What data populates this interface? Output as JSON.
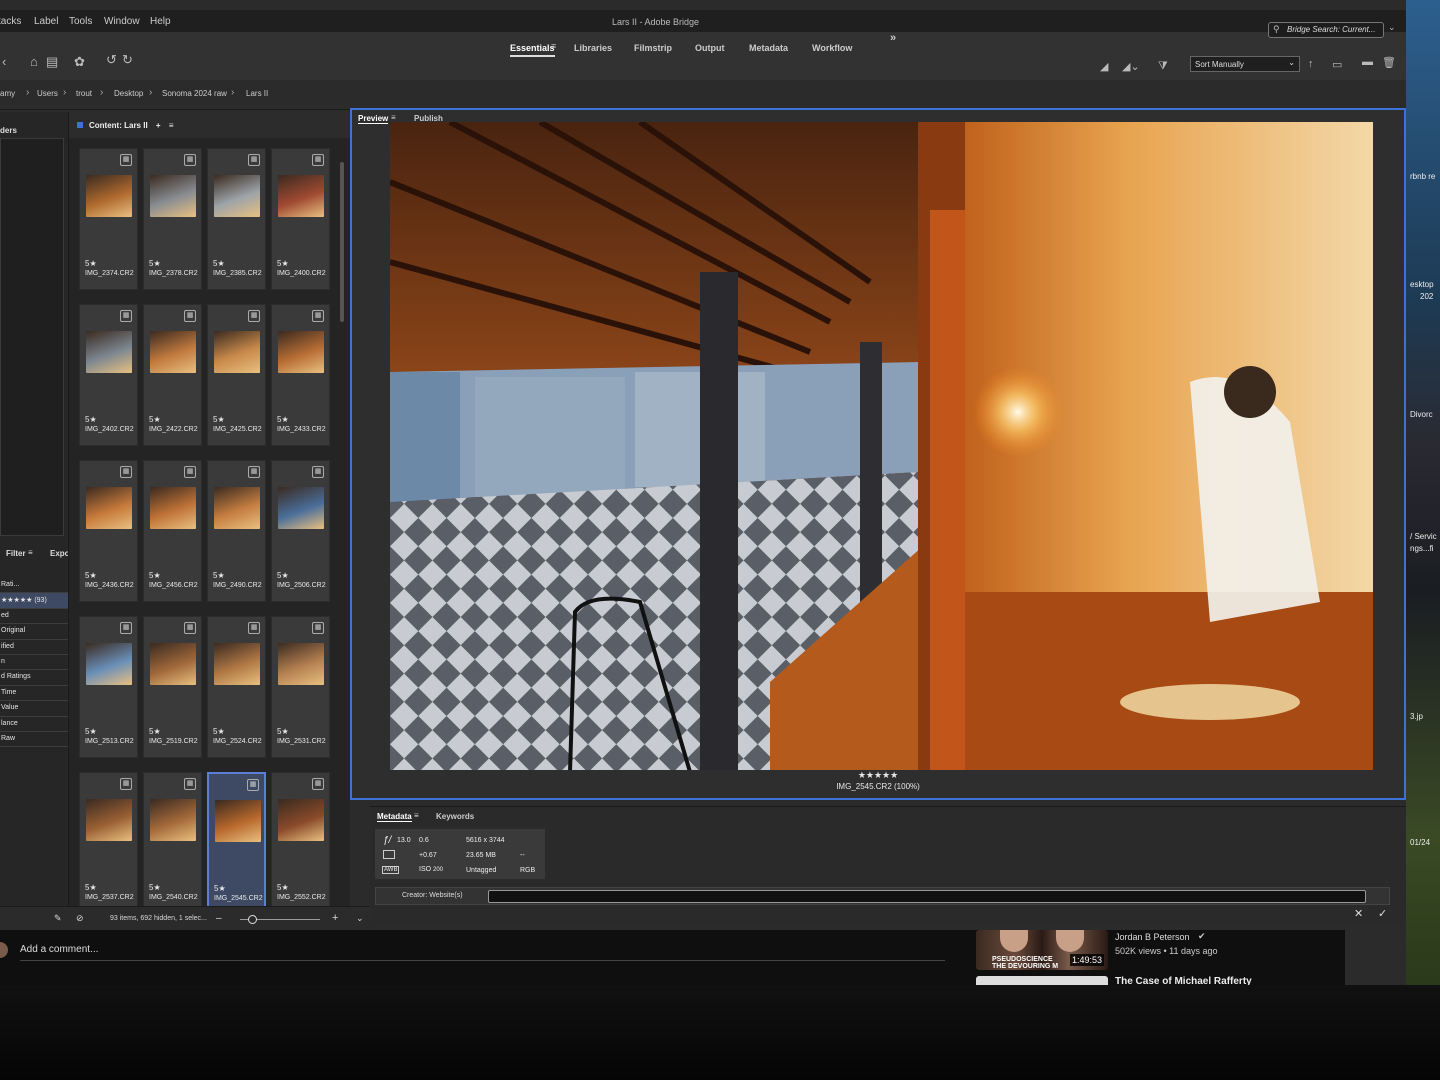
{
  "window": {
    "title": "Lars II - Adobe Bridge"
  },
  "menu": [
    "tacks",
    "Label",
    "Tools",
    "Window",
    "Help"
  ],
  "workspaces": {
    "items": [
      "Essentials",
      "Libraries",
      "Filmstrip",
      "Output",
      "Metadata",
      "Workflow"
    ],
    "active": "Essentials",
    "more": "»"
  },
  "search": {
    "placeholder": "Bridge Search: Current..."
  },
  "sort": {
    "value": "Sort Manually"
  },
  "breadcrumb": [
    "amy",
    "Users",
    "trout",
    "Desktop",
    "Sonoma 2024 raw",
    "Lars II"
  ],
  "left_panel": {
    "favorites_label": "ders",
    "filter_tab": "Filter",
    "export_tab": "Expo",
    "filter_rows": [
      "Rati...",
      "★★★★★ (93)",
      "ed",
      "Original",
      "ified",
      "n",
      "d Ratings",
      "Time",
      "Value",
      "lance",
      "Raw"
    ]
  },
  "content": {
    "header": "Content: Lars II",
    "status": "93 items, 692 hidden, 1 selec...",
    "thumbnails": [
      {
        "name": "IMG_2374.CR2",
        "stars": "5★",
        "color": "#b06a2e"
      },
      {
        "name": "IMG_2378.CR2",
        "stars": "5★",
        "color": "#8a8d92"
      },
      {
        "name": "IMG_2385.CR2",
        "stars": "5★",
        "color": "#9da3a8"
      },
      {
        "name": "IMG_2400.CR2",
        "stars": "5★",
        "color": "#a04a32"
      },
      {
        "name": "IMG_2402.CR2",
        "stars": "5★",
        "color": "#7d8790"
      },
      {
        "name": "IMG_2422.CR2",
        "stars": "5★",
        "color": "#c27a3e"
      },
      {
        "name": "IMG_2425.CR2",
        "stars": "5★",
        "color": "#c98a4a"
      },
      {
        "name": "IMG_2433.CR2",
        "stars": "5★",
        "color": "#b86d34"
      },
      {
        "name": "IMG_2436.CR2",
        "stars": "5★",
        "color": "#c6793a"
      },
      {
        "name": "IMG_2456.CR2",
        "stars": "5★",
        "color": "#bf7236"
      },
      {
        "name": "IMG_2490.CR2",
        "stars": "5★",
        "color": "#c57e40"
      },
      {
        "name": "IMG_2506.CR2",
        "stars": "5★",
        "color": "#4a6e9a"
      },
      {
        "name": "IMG_2513.CR2",
        "stars": "5★",
        "color": "#6a8fb8"
      },
      {
        "name": "IMG_2519.CR2",
        "stars": "5★",
        "color": "#a0683a"
      },
      {
        "name": "IMG_2524.CR2",
        "stars": "5★",
        "color": "#b07844"
      },
      {
        "name": "IMG_2531.CR2",
        "stars": "5★",
        "color": "#b48050"
      },
      {
        "name": "IMG_2537.CR2",
        "stars": "5★",
        "color": "#9a6034"
      },
      {
        "name": "IMG_2540.CR2",
        "stars": "5★",
        "color": "#a56a3a"
      },
      {
        "name": "IMG_2545.CR2",
        "stars": "5★",
        "color": "#b8682c",
        "selected": true
      },
      {
        "name": "IMG_2552.CR2",
        "stars": "5★",
        "color": "#8a4a2a"
      }
    ]
  },
  "preview": {
    "tabs": [
      "Preview",
      "Publish"
    ],
    "stars": "★★★★★",
    "caption": "IMG_2545.CR2 (100%)"
  },
  "metadata": {
    "tabs": [
      "Metadata",
      "Keywords"
    ],
    "aperture_label": "ƒ/",
    "aperture": "13.0",
    "shutter": "0.6",
    "exposure_comp": "+0.67",
    "iso_label": "ISO",
    "iso": "200",
    "awb": "AWB",
    "dimensions": "5616 x 3744",
    "file_size": "23.65 MB",
    "profile": "Untagged",
    "dash": "--",
    "color_mode": "RGB",
    "creator_label": "Creator: Website(s)"
  },
  "youtube": {
    "comment_placeholder": "Add a comment...",
    "thumb_text_1": "PSEUDOSCIENCE",
    "thumb_text_2": "THE DEVOURING M",
    "duration": "1:49:53",
    "channel": "Jordan B Peterson",
    "stats": "502K views • 11 days ago",
    "next_title": "The Case of Michael Rafferty"
  },
  "desktop_labels": [
    "rbnb re",
    "esktop",
    "202",
    "Divorc",
    "/ Servic",
    "ngs...fi",
    "3.jp",
    "01/24"
  ],
  "colors": {
    "accent": "#3f72d8",
    "selection": "#3e4a63"
  }
}
